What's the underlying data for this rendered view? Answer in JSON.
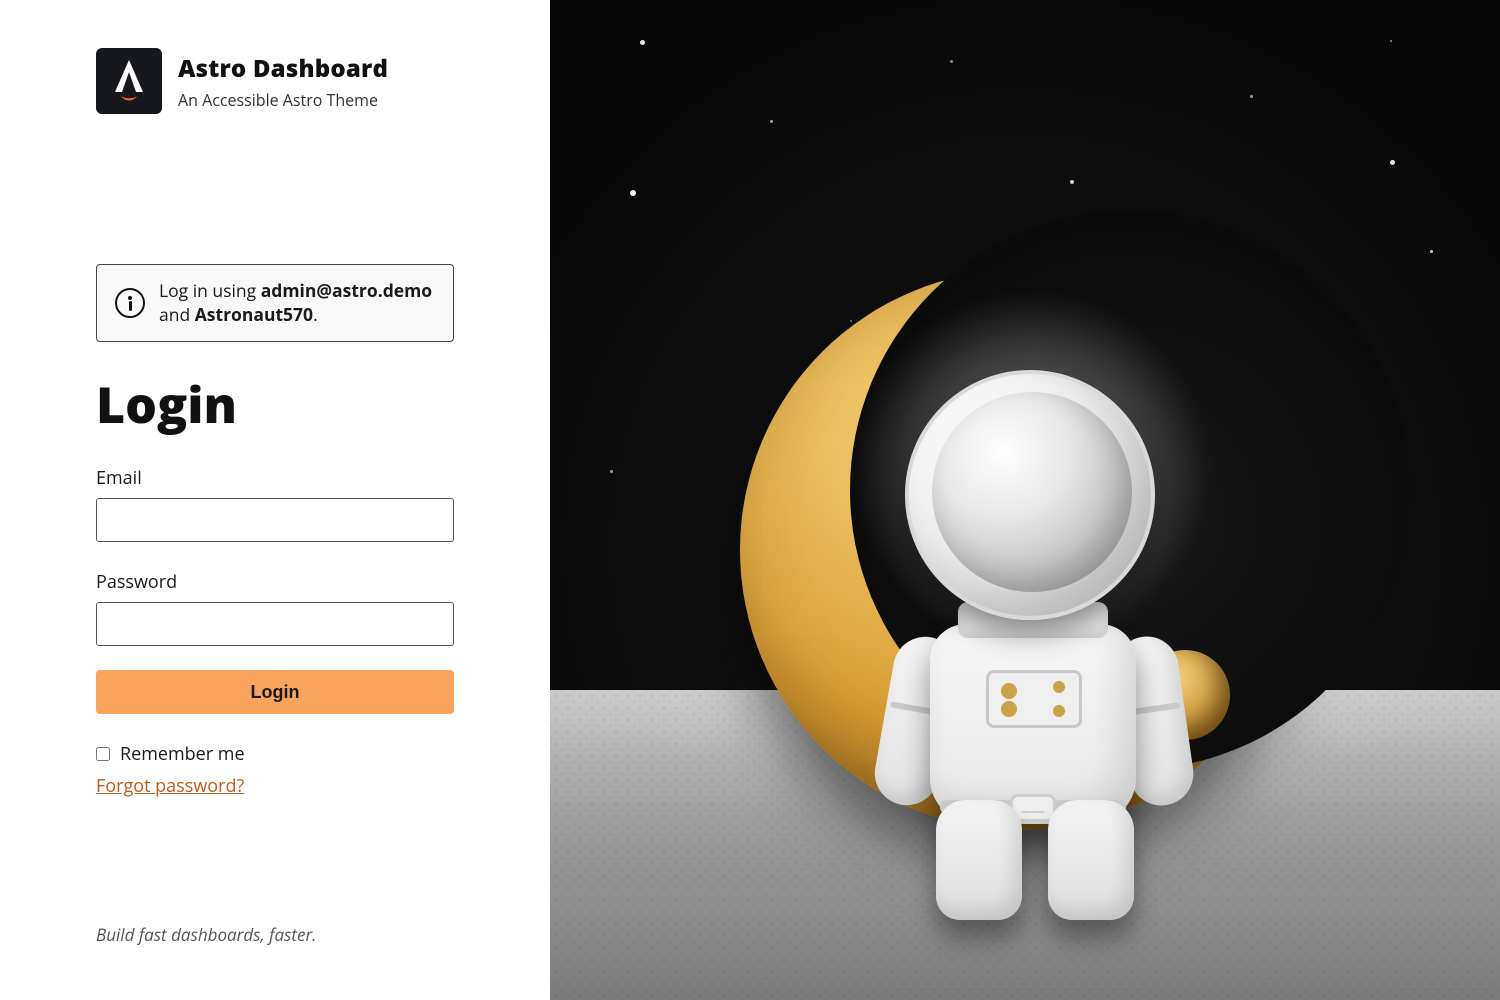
{
  "brand": {
    "title": "Astro Dashboard",
    "subtitle": "An Accessible Astro Theme"
  },
  "notification": {
    "prefix": "Log in using ",
    "email": "admin@astro.demo",
    "middle": " and ",
    "password": "Astronaut570",
    "suffix": "."
  },
  "login": {
    "heading": "Login",
    "email_label": "Email",
    "email_value": "",
    "password_label": "Password",
    "password_value": "",
    "submit_label": "Login",
    "remember_label": "Remember me",
    "remember_checked": false,
    "forgot_label": "Forgot password?"
  },
  "footer": {
    "note": "Build fast dashboards, faster."
  },
  "colors": {
    "accent": "#f8a45c",
    "link": "#c05a17"
  }
}
